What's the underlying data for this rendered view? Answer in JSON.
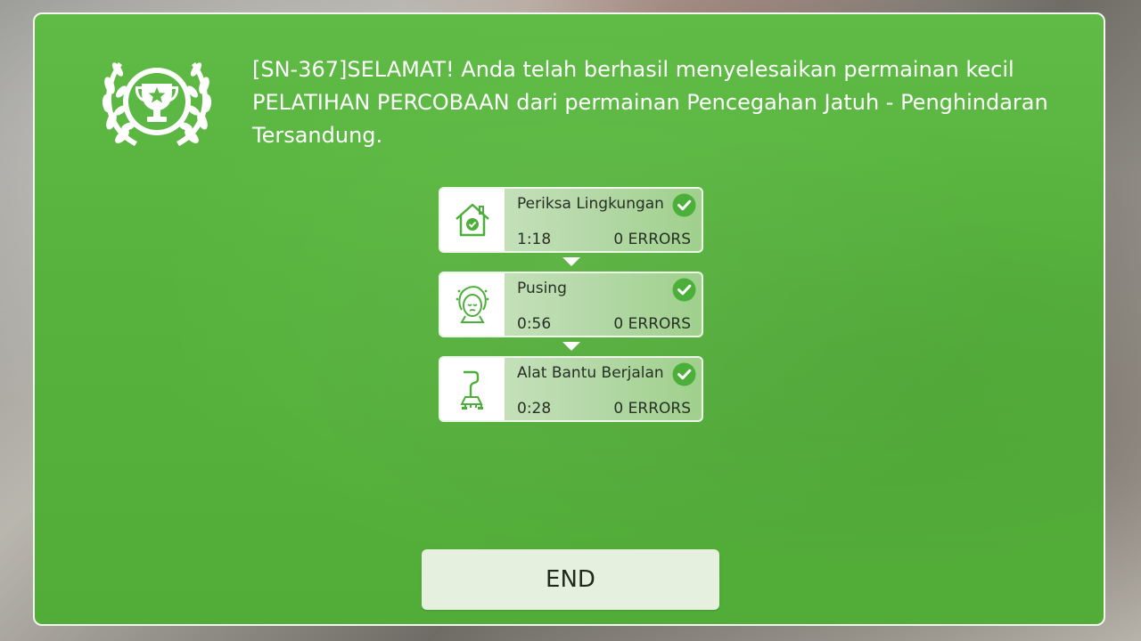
{
  "message": "[SN-367]SELAMAT! Anda telah berhasil menyelesaikan permainan kecil PELATIHAN PERCOBAAN dari permainan Pencegahan Jatuh - Penghindaran Tersandung.",
  "badge_icon": "trophy-laurel-icon",
  "tasks": [
    {
      "title": "Periksa Lingkungan",
      "time": "1:18",
      "errors": "0 ERRORS",
      "icon": "house-check-icon",
      "status": "completed"
    },
    {
      "title": "Pusing",
      "time": "0:56",
      "errors": "0 ERRORS",
      "icon": "dizzy-face-icon",
      "status": "completed"
    },
    {
      "title": "Alat Bantu Berjalan",
      "time": "0:28",
      "errors": "0 ERRORS",
      "icon": "walking-cane-icon",
      "status": "completed"
    }
  ],
  "end_button": "END",
  "colors": {
    "panel_green": "#56b23c",
    "check_green": "#4caf3a",
    "card_light": "#cfe6c6",
    "button_bg": "#e5f0de"
  }
}
